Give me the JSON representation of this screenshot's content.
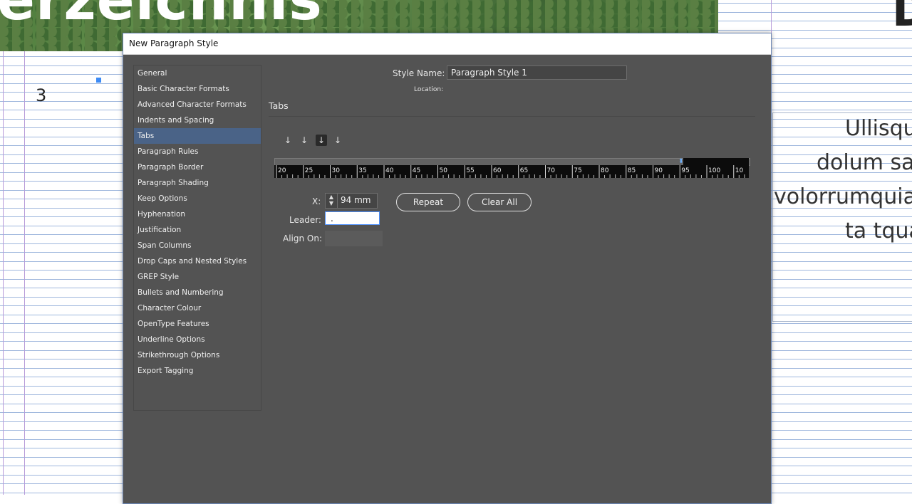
{
  "background": {
    "hero_title": "erzeichnis",
    "page_number": "3",
    "right_heading": "D",
    "body_lines": [
      "Ullisqu",
      "dolum sa",
      "volorrumquia",
      "ta tqua"
    ]
  },
  "dialog": {
    "title": "New Paragraph Style",
    "style_name_label": "Style Name:",
    "style_name_value": "Paragraph Style 1",
    "location_label": "Location:",
    "section_title": "Tabs",
    "categories": [
      "General",
      "Basic Character Formats",
      "Advanced Character Formats",
      "Indents and Spacing",
      "Tabs",
      "Paragraph Rules",
      "Paragraph Border",
      "Paragraph Shading",
      "Keep Options",
      "Hyphenation",
      "Justification",
      "Span Columns",
      "Drop Caps and Nested Styles",
      "GREP Style",
      "Bullets and Numbering",
      "Character Colour",
      "OpenType Features",
      "Underline Options",
      "Strikethrough Options",
      "Export Tagging"
    ],
    "selected_category": "Tabs",
    "tab_alignment_buttons": [
      {
        "name": "left-justified-tab-icon",
        "glyph": "↓"
      },
      {
        "name": "center-justified-tab-icon",
        "glyph": "↓"
      },
      {
        "name": "right-justified-tab-icon",
        "glyph": "↓"
      },
      {
        "name": "align-to-decimal-tab-icon",
        "glyph": "↓"
      }
    ],
    "active_tab_button": 2,
    "ruler": {
      "labels": [
        "20",
        "25",
        "30",
        "35",
        "40",
        "45",
        "50",
        "55",
        "60",
        "65",
        "70",
        "75",
        "80",
        "85",
        "90",
        "95",
        "100",
        "10"
      ],
      "tab_marker_value": 94
    },
    "x_label": "X:",
    "x_value": "94 mm",
    "leader_label": "Leader:",
    "leader_value": ".",
    "align_on_label": "Align On:",
    "align_on_value": "",
    "repeat_label": "Repeat",
    "clear_all_label": "Clear All"
  },
  "colors": {
    "dialog_bg": "#535353",
    "selected_item": "#4a6387",
    "focus_border": "#4d90fe"
  }
}
